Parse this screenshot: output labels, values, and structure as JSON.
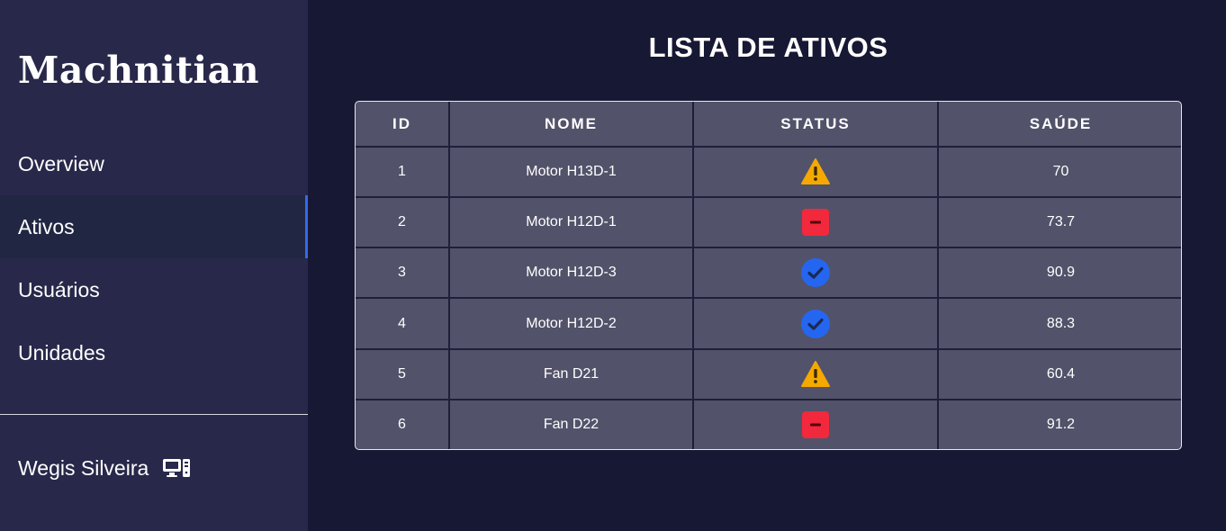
{
  "brand": "Machnitian",
  "nav": {
    "items": [
      {
        "label": "Overview",
        "active": false
      },
      {
        "label": "Ativos",
        "active": true
      },
      {
        "label": "Usuários",
        "active": false
      },
      {
        "label": "Unidades",
        "active": false
      }
    ],
    "accent_color": "#2f6bf0"
  },
  "user": {
    "name": "Wegis Silveira",
    "icon": "desktop-computer-icon"
  },
  "page": {
    "title": "LISTA DE ATIVOS"
  },
  "table": {
    "headers": [
      "ID",
      "NOME",
      "STATUS",
      "SAÚDE"
    ],
    "rows": [
      {
        "id": "1",
        "name": "Motor H13D-1",
        "status": "warning",
        "status_icon": "warning-triangle-icon",
        "health": "70"
      },
      {
        "id": "2",
        "name": "Motor H12D-1",
        "status": "stopped",
        "status_icon": "minus-square-icon",
        "health": "73.7"
      },
      {
        "id": "3",
        "name": "Motor H12D-3",
        "status": "ok",
        "status_icon": "check-circle-icon",
        "health": "90.9"
      },
      {
        "id": "4",
        "name": "Motor H12D-2",
        "status": "ok",
        "status_icon": "check-circle-icon",
        "health": "88.3"
      },
      {
        "id": "5",
        "name": "Fan D21",
        "status": "warning",
        "status_icon": "warning-triangle-icon",
        "health": "60.4"
      },
      {
        "id": "6",
        "name": "Fan D22",
        "status": "stopped",
        "status_icon": "minus-square-icon",
        "health": "91.2"
      }
    ]
  },
  "status_colors": {
    "warning": "#f5a800",
    "stopped": "#f2283c",
    "ok": "#2566f0"
  }
}
